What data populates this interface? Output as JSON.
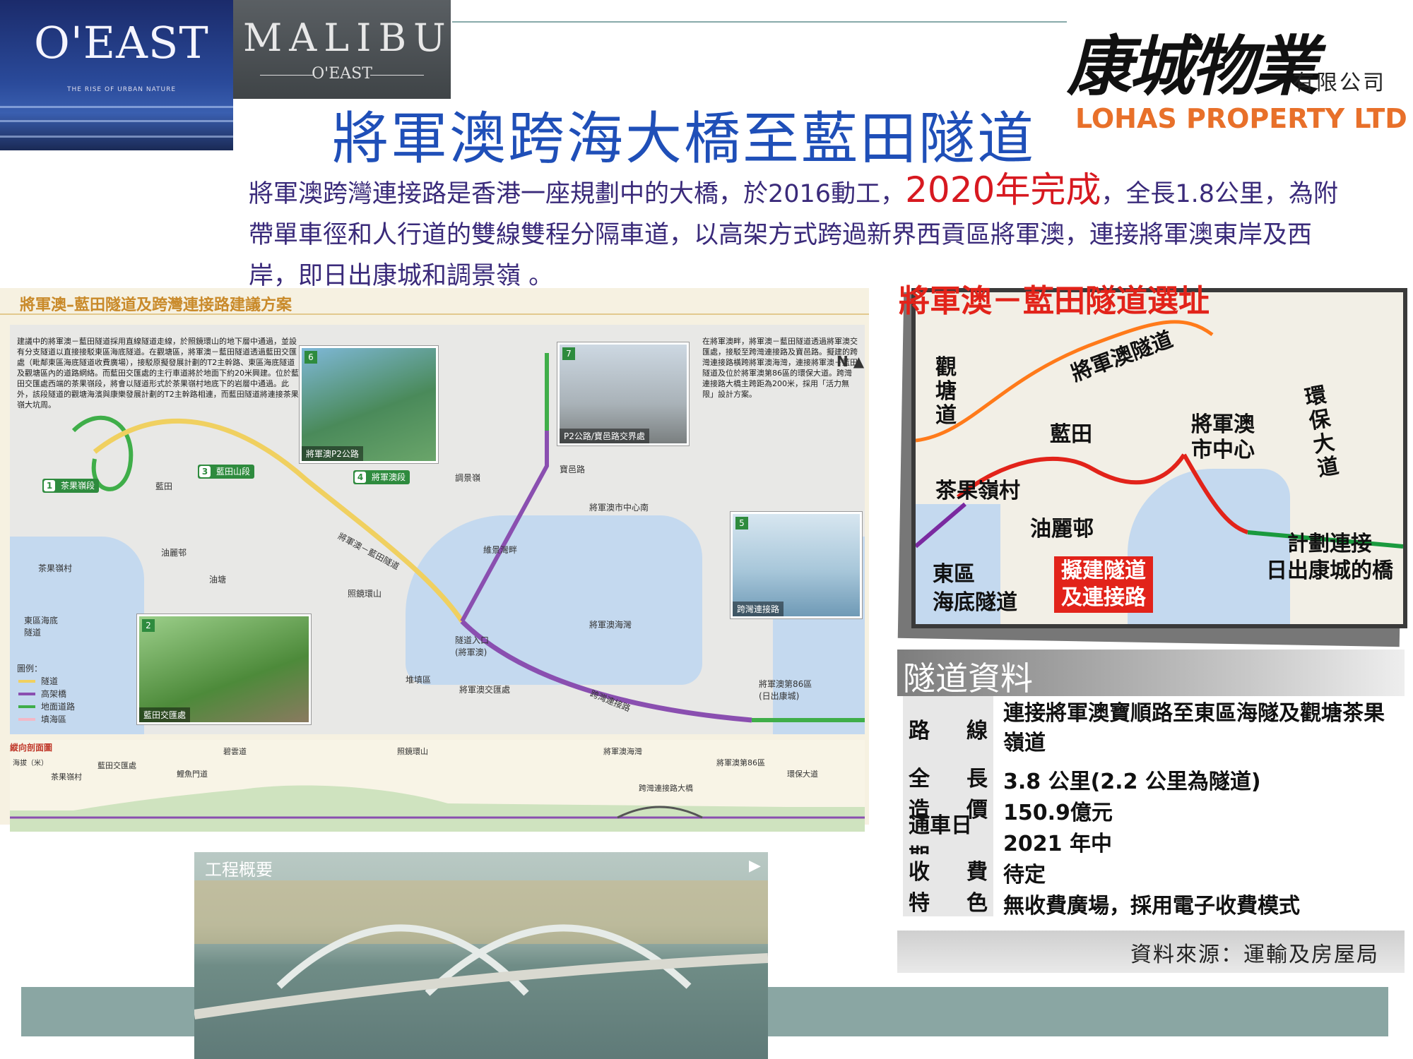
{
  "logos": {
    "oeast_name": "O'EAST",
    "oeast_tagline": "THE RISE OF URBAN NATURE",
    "malibu_name": "MALIBU",
    "malibu_sub": "O'EAST",
    "lohas_script": "康城物業",
    "lohas_cn_suffix": "有限公司",
    "lohas_en": "LOHAS PROPERTY LTD"
  },
  "header": {
    "title": "將軍澳跨海大橋至藍田隧道"
  },
  "intro": {
    "part1": "將軍澳跨灣連接路是香港一座規劃中的大橋，於2016動工，",
    "highlight": "2020年完成",
    "part2": "，全長1.8公里，為附帶單車徑和人行道的雙線雙程分隔車道，以高架方式跨過新界西貢區將軍澳，連接將軍澳東岸及西岸，即日出康城和調景嶺 。"
  },
  "plan": {
    "title": "將軍澳–藍田隧道及跨灣連接路建議方案",
    "desc_left": "建議中的將軍澳－藍田隧道採用直線隧道走線，於照鏡環山的地下層中通過，並設有分支隧道以直接接駁東區海底隧道。在觀塘區，將軍澳－藍田隧道透過藍田交匯處（毗鄰東區海底隧道收費廣場），接駁原擬發展計劃的T2主幹路、東區海底隧道及觀塘區內的道路網絡。而藍田交匯處的主行車道將於地面下約20米興建。位於藍田交匯處西端的茶果嶺段，將會以隧道形式於茶果嶺村地底下的岩層中通過。此外，該段隧道的觀塘海濱與康樂發展計劃的T2主幹路相連，而藍田隧道將連接茶果嶺大坑周。",
    "desc_right": "在將軍澳畔，將軍澳－藍田隧道透過將軍澳交匯處，接駁至跨灣連接路及寶邑路。擬建的跨灣連接路橫跨將軍澳海灣，連接將軍澳－藍田隧道及位於將軍澳第86區的環保大道。跨灣連接路大橋主跨距為200米，採用「活力無限」設計方案。",
    "sections": [
      {
        "num": "1",
        "label": "茶果嶺段"
      },
      {
        "num": "2",
        "label": "藍田交匯處"
      },
      {
        "num": "3",
        "label": "藍田山段"
      },
      {
        "num": "4",
        "label": "將軍澳段"
      },
      {
        "num": "5",
        "label": "跨灣連接路"
      }
    ],
    "photos": [
      {
        "num": "6",
        "caption": "將軍澳P2公路"
      },
      {
        "num": "7",
        "caption": "P2公路/寶邑路交界處"
      },
      {
        "num": "2",
        "caption": "藍田交匯處"
      },
      {
        "num": "5",
        "caption": "跨灣連接路"
      }
    ],
    "places": {
      "lam_tin": "藍田",
      "yau_lai": "油麗邨",
      "yau_tong": "油塘",
      "cha_kwo_ling": "茶果嶺村",
      "ehc": "東區海底隧道",
      "tunnel_road": "將軍澳－藍田隧道",
      "chiu_keng": "照鏡環山",
      "tiu_keng_leng": "調景嶺",
      "po_yap": "寶邑路",
      "tko_centre": "將軍澳市中心南",
      "wai_king": "維景灣畔",
      "tunnel_portal": "隧道入口\n(將軍澳)",
      "tko_interchange": "將軍澳交匯處",
      "tko_bay": "將軍澳海灣",
      "cross_bay": "跨灣連接路",
      "area86": "將軍澳第86區\n(日出康城)",
      "landfill": "堆填區",
      "wan_po": "環保大道",
      "p2": "將軍澳P2公路"
    },
    "legend_title": "圖例：",
    "legend": [
      {
        "label": "隧道",
        "color": "#f0d060"
      },
      {
        "label": "高架橋",
        "color": "#8a4fb0"
      },
      {
        "label": "地面道路",
        "color": "#3fae49"
      },
      {
        "label": "填海區",
        "color": "#f2b8c6"
      }
    ],
    "profile_title": "縱向剖面圖",
    "profile_labels": {
      "axis": "海拔（米）",
      "cha_kwo_ling": "茶果嶺村",
      "lam_tin_ic": "藍田交匯處",
      "lei_yue_mun": "鯉魚門道",
      "bik_wan": "碧雲道",
      "chiu_keng": "照鏡環山",
      "tko_bay": "將軍澳海灣",
      "bridge": "跨灣連接路大橋",
      "area86": "將軍澳第86區",
      "wan_po": "環保大道"
    }
  },
  "right_map": {
    "title": "將軍澳－藍田隧道選址",
    "labels": {
      "tko_tunnel": "將軍澳隧道",
      "kwun_tong": "觀塘道",
      "lam_tin": "藍田",
      "tko_centre": "將軍澳\n市中心",
      "wan_po": "環保大道",
      "cha_kwo_ling": "茶果嶺村",
      "yau_lai": "油麗邨",
      "ehc": "東區\n海底隧道",
      "proposed": "擬建隧道\n及連接路",
      "planned_bridge": "計劃連接\n日出康城的橋"
    }
  },
  "tunnel_info": {
    "heading": "隧道資料",
    "rows": [
      {
        "key_a": "路",
        "key_b": "線",
        "value": "連接將軍澳寶順路至東區海隧及觀塘茶果嶺道"
      },
      {
        "key_a": "全",
        "key_b": "長",
        "value": "3.8 公里(2.2 公里為隧道)"
      },
      {
        "key_a": "造",
        "key_b": "價",
        "value": "150.9億元"
      },
      {
        "key_a": "通車日期",
        "key_b": "",
        "value": "2021 年中"
      },
      {
        "key_a": "收",
        "key_b": "費",
        "value": "待定"
      },
      {
        "key_a": "特",
        "key_b": "色",
        "value": "無收費廣場，採用電子收費模式"
      }
    ],
    "source": "資料來源：運輸及房屋局"
  },
  "bottom_photo": {
    "label": "工程概要",
    "play_icon": "▶"
  }
}
